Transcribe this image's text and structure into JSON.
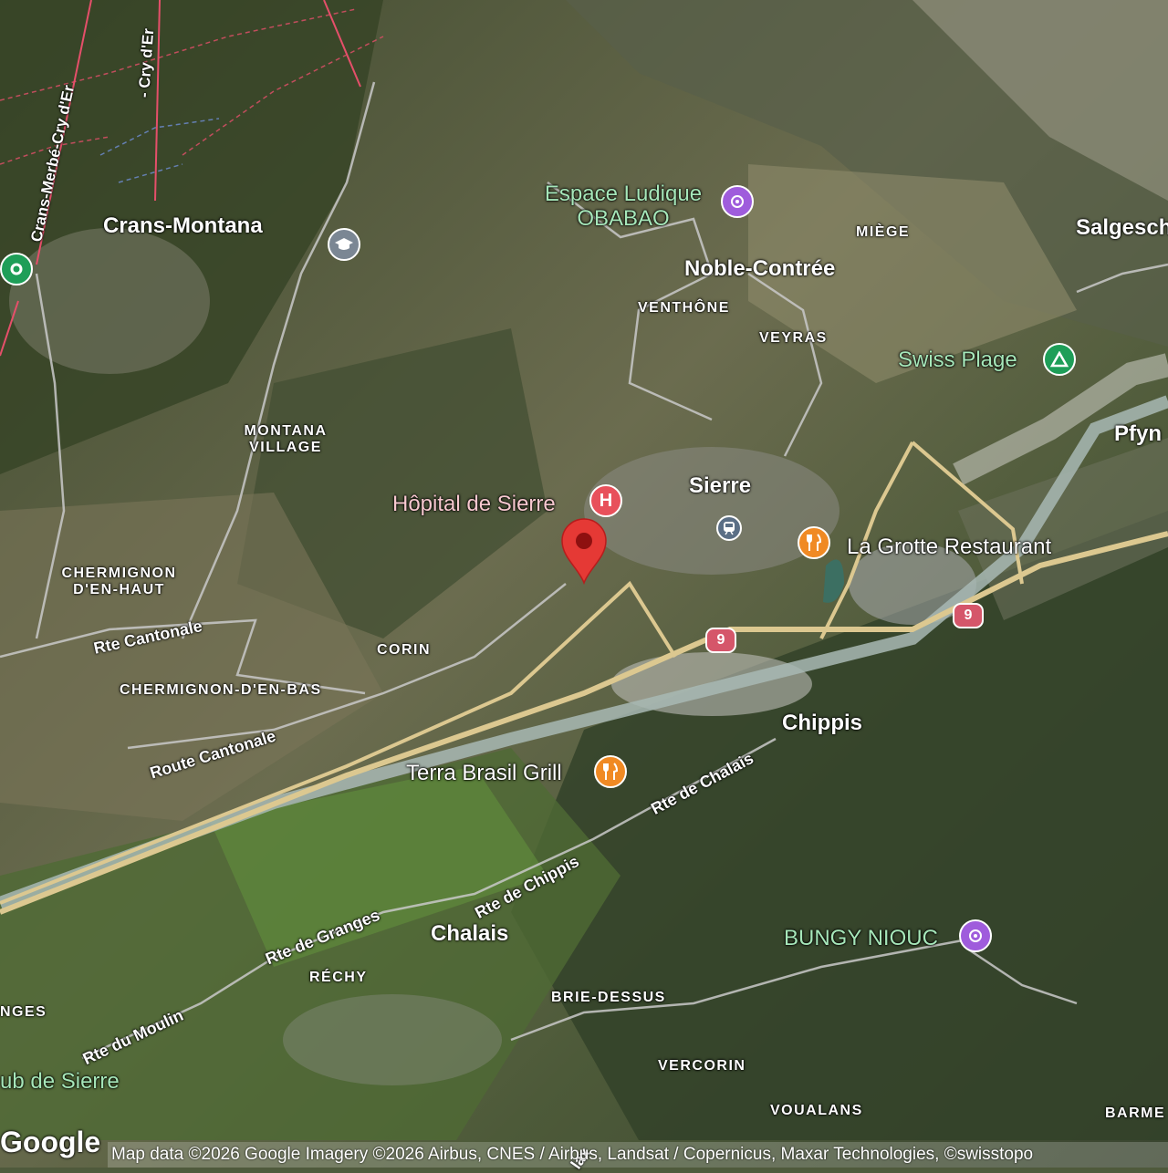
{
  "map": {
    "towns": {
      "crans_montana": "Crans-Montana",
      "noble_contree": "Noble-Contrée",
      "sierre": "Sierre",
      "chippis": "Chippis",
      "chalais": "Chalais",
      "salgesch": "Salgesch",
      "pfyn": "Pfyn"
    },
    "villages": {
      "miege": "MIÈGE",
      "venthone": "VENTHÔNE",
      "veyras": "VEYRAS",
      "montana_village": "MONTANA VILLAGE",
      "chermignon_haut": "CHERMIGNON D'EN-HAUT",
      "chermignon_bas": "CHERMIGNON-D'EN-BAS",
      "corin": "CORIN",
      "rechy": "RÉCHY",
      "brie_dessus": "BRIE-DESSUS",
      "vercorin": "VERCORIN",
      "voualans": "VOUALANS",
      "barmes": "BARME",
      "granges": "NGES"
    },
    "roads": {
      "rte_cantonale": "Rte Cantonale",
      "route_cantonale": "Route Cantonale",
      "rte_de_chalais": "Rte de Chalais",
      "rte_de_chippis": "Rte de Chippis",
      "rte_de_granges": "Rte de Granges",
      "rte_du_moulin": "Rte du Moulin",
      "crans_merbe": "Crans-Merbé-Cry d'Er",
      "cry_der": "- Cry d'Er",
      "lax": "lax"
    },
    "highway_shield": "9",
    "pois": {
      "espace_ludique": "Espace Ludique OBABAO",
      "hopital": "Hôpital de Sierre",
      "swiss_plage": "Swiss Plage",
      "la_grotte": "La Grotte Restaurant",
      "terra_brasil": "Terra Brasil Grill",
      "bungy": "BUNGY NIOUC",
      "golf_club": "ub de Sierre"
    },
    "hospital_glyph": "H",
    "attribution": "Map data ©2026 Google Imagery ©2026 Airbus, CNES / Airbus, Landsat / Copernicus, Maxar Technologies, ©swisstopo",
    "logo": "Google",
    "colors": {
      "hospital_pin": "#e8505b",
      "restaurant_pin": "#f08a24",
      "activity_pin": "#9f5cdc",
      "camp_pin": "#1e9e58",
      "school_pin": "#7b8794",
      "transit_pin": "#5b6f86",
      "location_marker": "#e53935",
      "highway": "#dcc890",
      "river": "#a8b8b4"
    },
    "icons": [
      "hospital-icon",
      "restaurant-icon",
      "activity-icon",
      "campground-icon",
      "school-icon",
      "train-icon",
      "location-marker-icon",
      "park-icon"
    ]
  }
}
